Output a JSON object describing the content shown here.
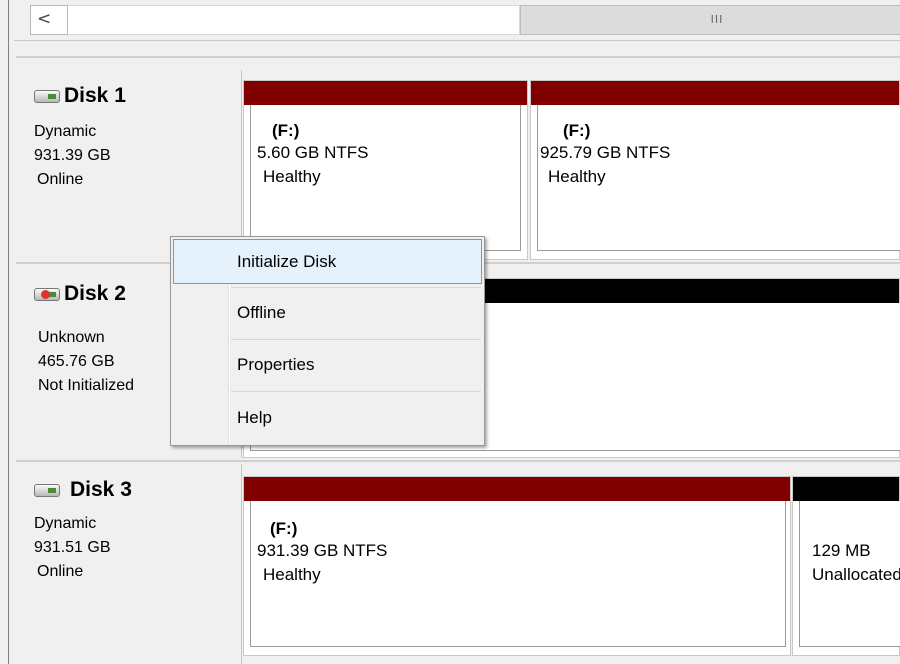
{
  "scrollbar": {
    "left_arrow": "<",
    "thumb_grip": "III"
  },
  "disks": [
    {
      "name": "Disk 1",
      "type": "Dynamic",
      "size": "931.39 GB",
      "status": "Online",
      "partitions": [
        {
          "label": "(F:)",
          "size": "5.60 GB NTFS",
          "status": "Healthy"
        },
        {
          "label": "(F:)",
          "size": "925.79 GB NTFS",
          "status": "Healthy"
        }
      ]
    },
    {
      "name": "Disk 2",
      "type": "Unknown",
      "size": "465.76 GB",
      "status": "Not Initialized",
      "partitions": []
    },
    {
      "name": "Disk 3",
      "type": "Dynamic",
      "size": "931.51 GB",
      "status": "Online",
      "partitions": [
        {
          "label": "(F:)",
          "size": "931.39 GB NTFS",
          "status": "Healthy"
        },
        {
          "label": "",
          "size": "129 MB",
          "status": "Unallocated"
        }
      ]
    }
  ],
  "context_menu": {
    "items": [
      "Initialize Disk",
      "Offline",
      "Properties",
      "Help"
    ],
    "highlighted": "Initialize Disk"
  },
  "colors": {
    "dynamic_volume_bar": "#800000",
    "unallocated_bar": "#000000",
    "menu_highlight": "#e5f1fb"
  }
}
